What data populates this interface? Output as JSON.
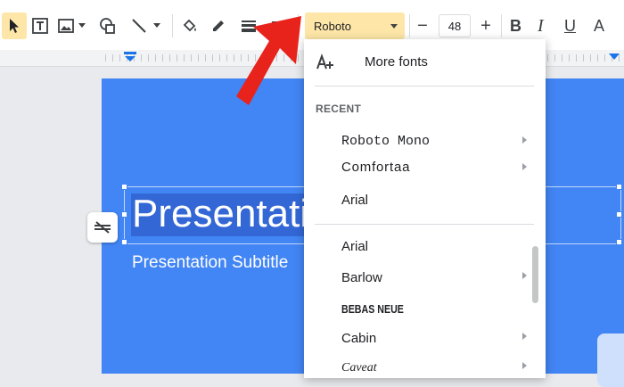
{
  "toolbar": {
    "font_name": "Roboto",
    "font_size": "48",
    "decrease_label": "−",
    "increase_label": "+",
    "bold_label": "B",
    "italic_label": "I",
    "underline_label": "U",
    "text_color_label": "A"
  },
  "slide": {
    "title": "Presentatio",
    "subtitle": "Presentation Subtitle"
  },
  "font_menu": {
    "more_fonts_label": "More fonts",
    "recent_header": "RECENT",
    "recent_fonts": [
      {
        "label": "Roboto Mono",
        "has_submenu": true
      },
      {
        "label": "Comfortaa",
        "has_submenu": true
      },
      {
        "label": "Arial",
        "has_submenu": false
      }
    ],
    "all_fonts": [
      {
        "label": "Arial",
        "has_submenu": false
      },
      {
        "label": "Barlow",
        "has_submenu": true
      },
      {
        "label": "BEBAS NEUE",
        "has_submenu": false
      },
      {
        "label": "Cabin",
        "has_submenu": true
      },
      {
        "label": "Caveat",
        "has_submenu": true
      }
    ]
  },
  "colors": {
    "slide_background": "#4285f4",
    "font_select_highlight": "#fde6a7",
    "annotation_arrow": "#e8231c"
  }
}
